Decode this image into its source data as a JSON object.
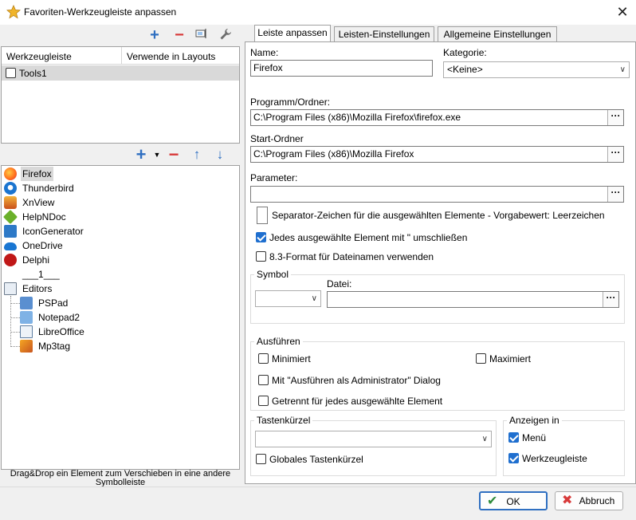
{
  "window": {
    "title": "Favoriten-Werkzeugleiste anpassen"
  },
  "colors": {
    "accent": "#1f6fcf",
    "icon_blue": "#2f6fc1",
    "icon_red": "#d83a3a",
    "selection": "#d9d9d9"
  },
  "layouts": {
    "headers": [
      "Werkzeugleiste",
      "Verwende in Layouts"
    ],
    "rows": [
      {
        "label": "Tools1",
        "checked": false
      }
    ]
  },
  "tree": {
    "items": [
      {
        "label": "Firefox",
        "icon": "firefox-icon",
        "selected": true
      },
      {
        "label": "Thunderbird",
        "icon": "thunderbird-icon"
      },
      {
        "label": "XnView",
        "icon": "xnview-icon"
      },
      {
        "label": "HelpNDoc",
        "icon": "helpndoc-icon"
      },
      {
        "label": "IconGenerator",
        "icon": "icongenerator-icon"
      },
      {
        "label": "OneDrive",
        "icon": "onedrive-icon"
      },
      {
        "label": "Delphi",
        "icon": "delphi-icon"
      },
      {
        "label": "___1___",
        "icon": ""
      },
      {
        "label": "Editors",
        "icon": "folder-tree-icon"
      },
      {
        "label": "PSPad",
        "icon": "pspad-icon"
      },
      {
        "label": "Notepad2",
        "icon": "notepad2-icon"
      },
      {
        "label": "LibreOffice",
        "icon": "libreoffice-icon"
      },
      {
        "label": "Mp3tag",
        "icon": "mp3tag-icon"
      }
    ]
  },
  "hint": "Drag&Drop ein Element zum Verschieben in eine andere Symbolleiste",
  "tabs": [
    "Leiste anpassen",
    "Leisten-Einstellungen",
    "Allgemeine Einstellungen"
  ],
  "form": {
    "name_label": "Name:",
    "name_value": "Firefox",
    "category_label": "Kategorie:",
    "category_value": "<Keine>",
    "program_label": "Programm/Ordner:",
    "program_value": "C:\\Program Files (x86)\\Mozilla Firefox\\firefox.exe",
    "start_label": "Start-Ordner",
    "start_value": "C:\\Program Files (x86)\\Mozilla Firefox",
    "param_label": "Parameter:",
    "param_value": "",
    "separator_label": "Separator-Zeichen für die ausgewählten Elemente - Vorgabewert: Leerzeichen",
    "quote_label": "Jedes ausgewählte Element mit \" umschließen",
    "quote_checked": true,
    "short83_label": "8.3-Format für Dateinamen verwenden",
    "short83_checked": false,
    "symbol_group": "Symbol",
    "file_label": "Datei:",
    "file_value": "",
    "execute_group": "Ausführen",
    "minimized_label": "Minimiert",
    "maximized_label": "Maximiert",
    "admin_label": "Mit \"Ausführen als Administrator\" Dialog",
    "separate_label": "Getrennt für jedes ausgewählte Element",
    "hotkey_group": "Tastenkürzel",
    "hotkey_value": "",
    "global_hotkey_label": "Globales Tastenkürzel",
    "show_group": "Anzeigen in",
    "show_menu_label": "Menü",
    "show_toolbar_label": "Werkzeugleiste",
    "show_menu_checked": true,
    "show_toolbar_checked": true,
    "dots": "···"
  },
  "buttons": {
    "ok": "OK",
    "cancel": "Abbruch"
  }
}
